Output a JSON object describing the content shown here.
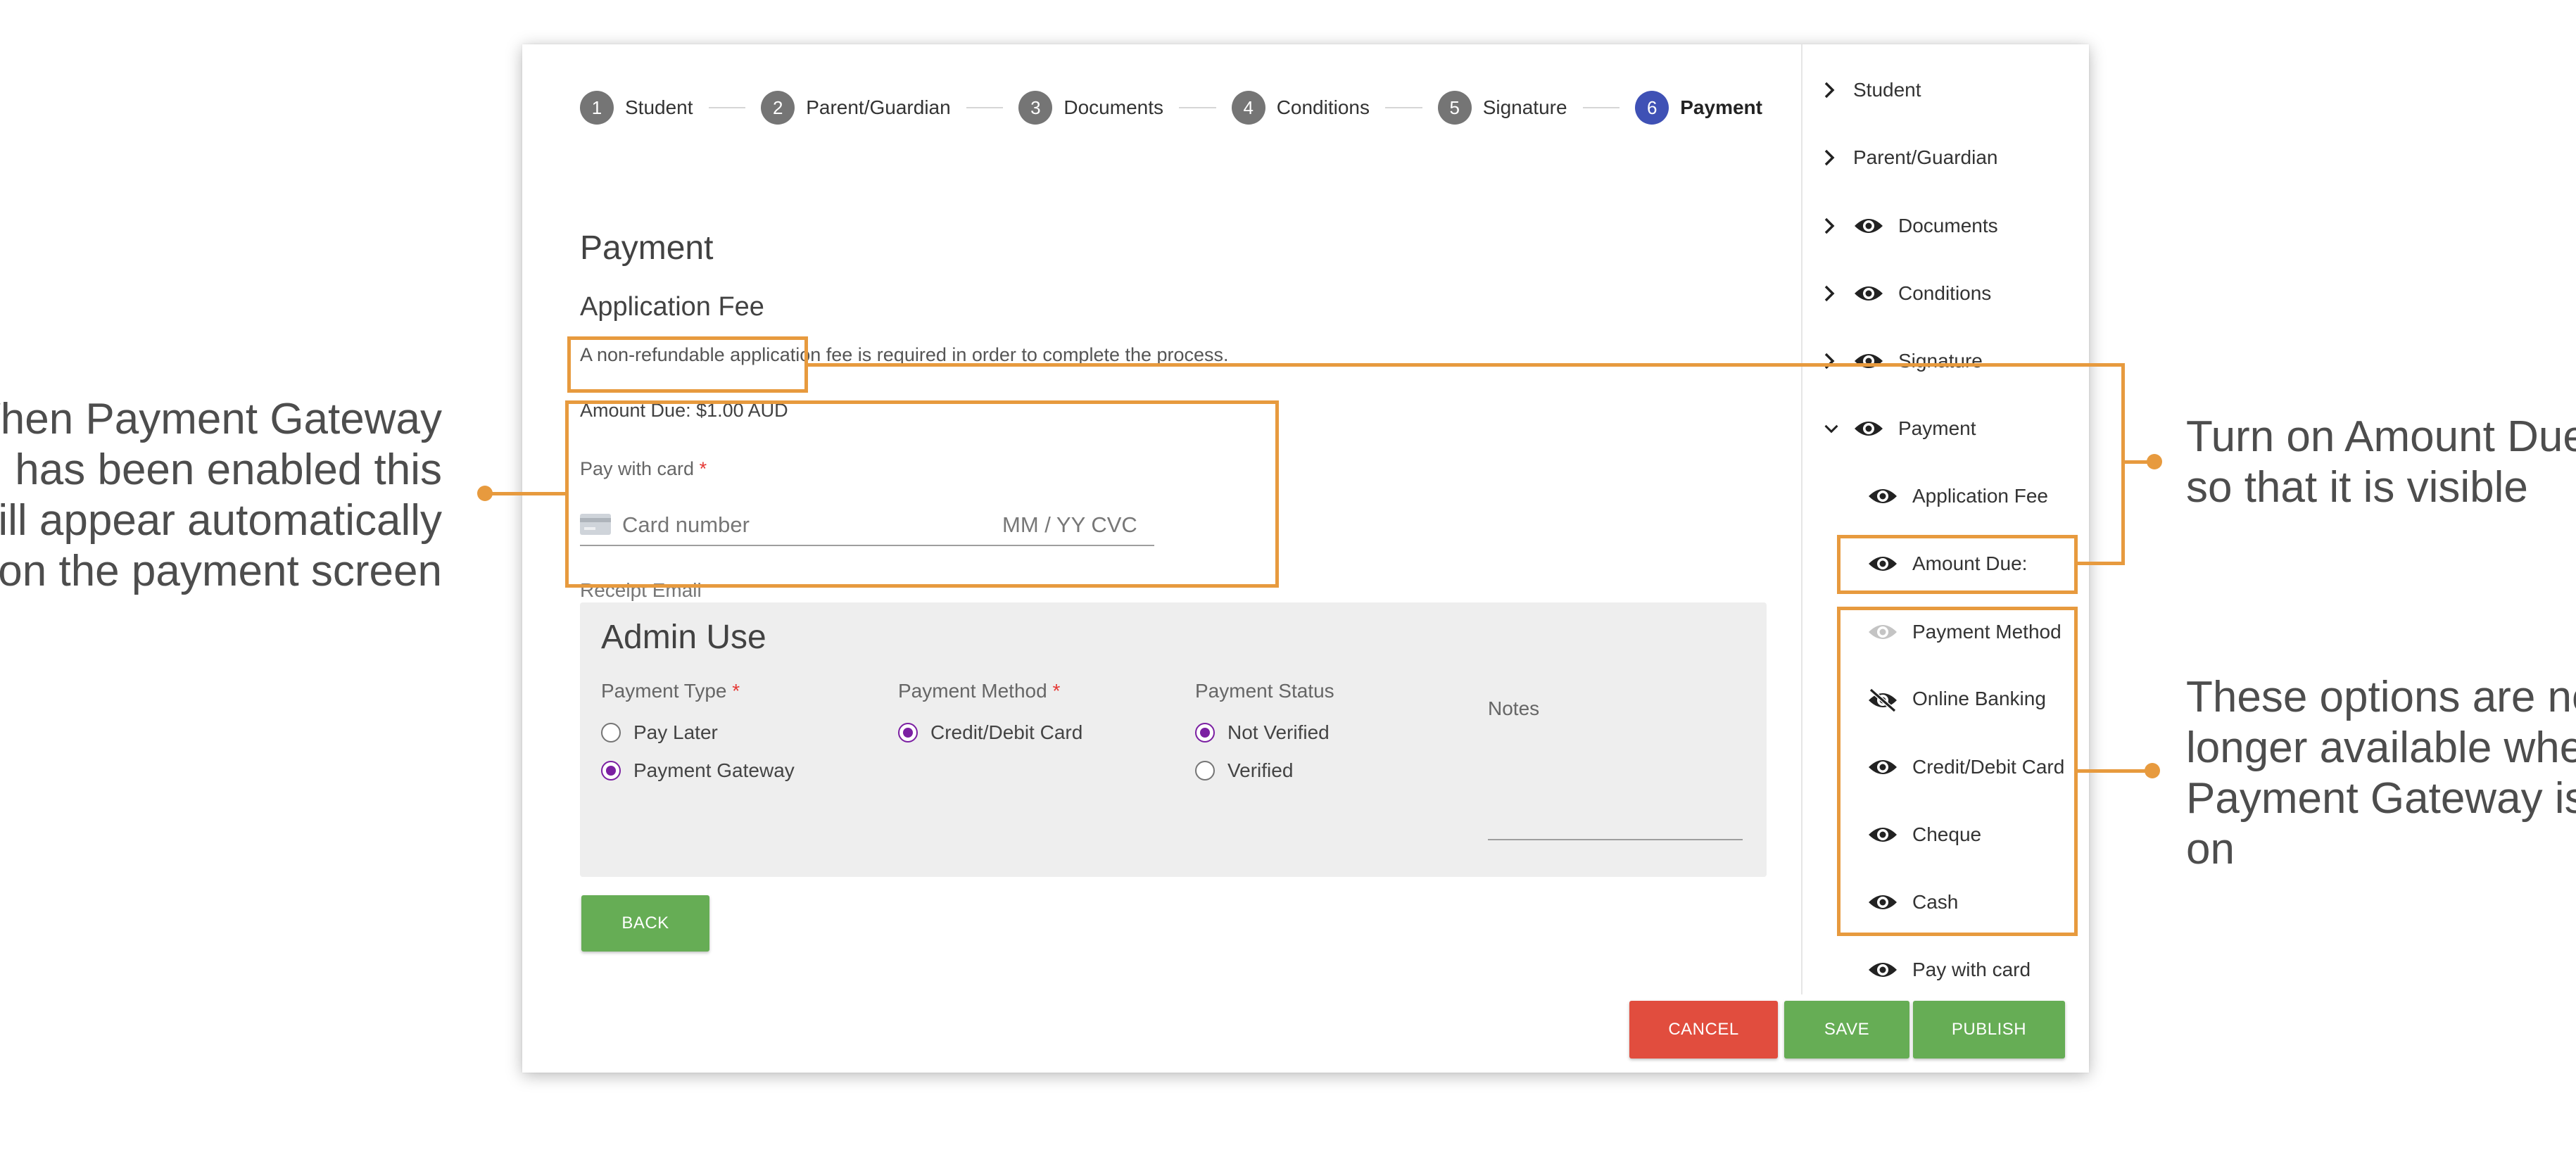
{
  "stepper": {
    "steps": [
      {
        "number": "1",
        "label": "Student"
      },
      {
        "number": "2",
        "label": "Parent/Guardian"
      },
      {
        "number": "3",
        "label": "Documents"
      },
      {
        "number": "4",
        "label": "Conditions"
      },
      {
        "number": "5",
        "label": "Signature"
      },
      {
        "number": "6",
        "label": "Payment",
        "active": true
      }
    ]
  },
  "main": {
    "title": "Payment",
    "subtitle": "Application Fee",
    "description": "A non-refundable application fee is required in order to complete the process.",
    "amount_due": "Amount Due: $1.00 AUD",
    "pay_with_card_label": "Pay with card",
    "required_mark": "*",
    "card_number_placeholder": "Card number",
    "expiry_cvc_placeholder": "MM / YY  CVC",
    "receipt_email_placeholder": "Receipt Email"
  },
  "admin": {
    "title": "Admin Use",
    "payment_type": {
      "label": "Payment Type",
      "options": [
        {
          "label": "Pay Later",
          "selected": false
        },
        {
          "label": "Payment Gateway",
          "selected": true
        }
      ]
    },
    "payment_method": {
      "label": "Payment Method",
      "options": [
        {
          "label": "Credit/Debit Card",
          "selected": true
        }
      ]
    },
    "payment_status": {
      "label": "Payment Status",
      "options": [
        {
          "label": "Not Verified",
          "selected": true
        },
        {
          "label": "Verified",
          "selected": false
        }
      ]
    },
    "notes_label": "Notes"
  },
  "buttons": {
    "back": "BACK",
    "cancel": "CANCEL",
    "save": "SAVE",
    "publish": "PUBLISH"
  },
  "tree": {
    "items": [
      {
        "label": "Student",
        "chevron": "right",
        "eye": "none"
      },
      {
        "label": "Parent/Guardian",
        "chevron": "right",
        "eye": "none"
      },
      {
        "label": "Documents",
        "chevron": "right",
        "eye": "visible"
      },
      {
        "label": "Conditions",
        "chevron": "right",
        "eye": "visible"
      },
      {
        "label": "Signature",
        "chevron": "right",
        "eye": "visible"
      },
      {
        "label": "Payment",
        "chevron": "down",
        "eye": "visible"
      },
      {
        "label": "Application Fee",
        "chevron": "none",
        "eye": "visible"
      },
      {
        "label": "Amount Due:",
        "chevron": "none",
        "eye": "visible"
      },
      {
        "label": "Payment Method",
        "chevron": "none",
        "eye": "disabled"
      },
      {
        "label": "Online Banking",
        "chevron": "none",
        "eye": "hidden"
      },
      {
        "label": "Credit/Debit Card",
        "chevron": "none",
        "eye": "visible"
      },
      {
        "label": "Cheque",
        "chevron": "none",
        "eye": "visible"
      },
      {
        "label": "Cash",
        "chevron": "none",
        "eye": "visible"
      },
      {
        "label": "Pay with card",
        "chevron": "none",
        "eye": "visible"
      }
    ]
  },
  "annotations": {
    "left": [
      "When Payment Gateway",
      "has been enabled this",
      "will appear automatically",
      "on the payment screen"
    ],
    "right_top": [
      "Turn on Amount Due",
      "so that it is visible"
    ],
    "right_bottom": [
      "These options are no",
      "longer available when",
      "Payment Gateway is",
      "on"
    ]
  },
  "colors": {
    "accent": "#e79a3e",
    "step_active": "#3f51b5",
    "radio_selected": "#7b1fa2",
    "green": "#66ad55",
    "red": "#e14d3e"
  }
}
